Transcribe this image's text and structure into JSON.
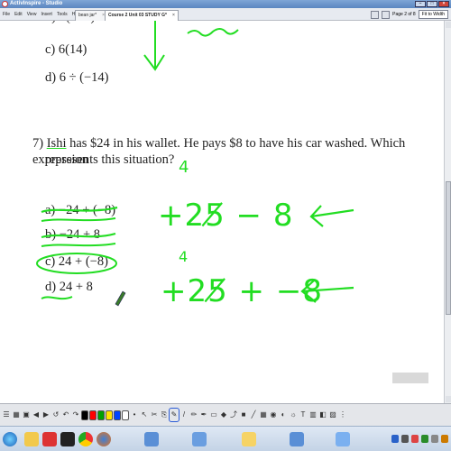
{
  "window": {
    "title": "ActivInspire - Studio"
  },
  "menu": [
    "File",
    "Edit",
    "View",
    "Insert",
    "Tools",
    "Help"
  ],
  "tabs": [
    {
      "label": "bean jar*",
      "active": false
    },
    {
      "label": "Course 2 Unit 03 STUDY G*",
      "active": true
    }
  ],
  "page_nav": {
    "label": "Page 2 of 8",
    "zoom": "Fit to Width"
  },
  "flipchart": {
    "prev_options": [
      {
        "label": "c) 6(14)"
      },
      {
        "label": "d) 6 ÷ (−14)"
      }
    ],
    "question": {
      "number": "7)",
      "name": "Ishi",
      "text_line1": "has $24 in his wallet. He pays $8 to have his car washed. Which expression",
      "text_line2": "represents this situation?"
    },
    "options": [
      {
        "label": "a) −24 + (−8)"
      },
      {
        "label": "b) −24 + 8"
      },
      {
        "label": "c) 24 + (−8)"
      },
      {
        "label": "d) 24 + 8"
      }
    ],
    "ink": {
      "line1": {
        "small": "4",
        "main": "+25̸ − 8"
      },
      "line2": {
        "small": "4",
        "main": "+25̸ + −8"
      },
      "color": "#22dd22"
    }
  },
  "colors": {
    "accent": "#2a5bd7",
    "ink_green": "#22dd22",
    "palette": [
      "#000000",
      "#ff0000",
      "#00a000",
      "#ffe400",
      "#0044ff",
      "#ffffff"
    ]
  },
  "toolbar_icons": [
    "pen-icon",
    "highlighter-icon",
    "eraser-icon",
    "select-icon",
    "text-icon",
    "shape-icon",
    "fill-icon",
    "undo-icon",
    "redo-icon"
  ],
  "taskbar_icons": [
    "start-icon",
    "file-explorer-icon",
    "acrobat-icon",
    "activinspire-icon",
    "chrome-icon",
    "firefox-icon"
  ]
}
